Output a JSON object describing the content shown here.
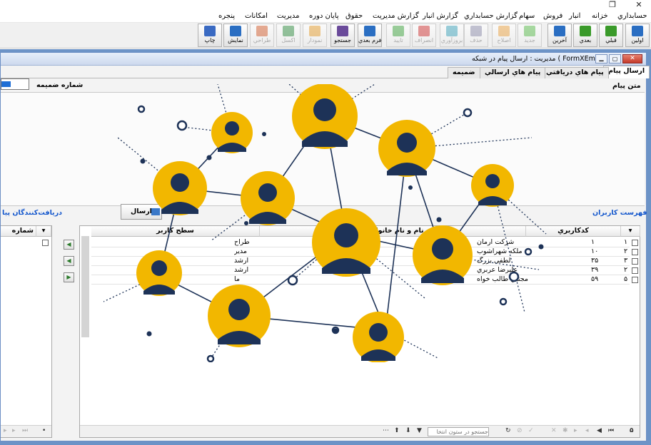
{
  "window": {
    "restore_icon": "restore-icon",
    "close_icon": "close-icon"
  },
  "menu": [
    "حسابداري",
    "خزانه",
    "انبار",
    "فروش",
    "سهام",
    "گزارش حسابداري",
    "گزارش انبار",
    "گزارش مديريت",
    "حقوق",
    "پايان دوره",
    "مديريت",
    "امكانات",
    "پنجره"
  ],
  "toolbar": [
    {
      "label": "اولين",
      "icon": "up-arrow-icon",
      "color": "#2a6ec2",
      "enabled": true
    },
    {
      "label": "قبلي",
      "icon": "right-arrow-icon",
      "color": "#3a9a2a",
      "enabled": true
    },
    {
      "label": "بعدي",
      "icon": "left-arrow-icon",
      "color": "#3a9a2a",
      "enabled": true
    },
    {
      "label": "آخرين",
      "icon": "down-arrow-icon",
      "color": "#2a6ec2",
      "enabled": true
    },
    {
      "label": "جديد",
      "icon": "plus-icon",
      "color": "#56b848",
      "enabled": false
    },
    {
      "label": "اصلاح",
      "icon": "pencil-icon",
      "color": "#e8a040",
      "enabled": false
    },
    {
      "label": "حذف",
      "icon": "trash-icon",
      "color": "#8a8aa8",
      "enabled": false
    },
    {
      "label": "بروزآوري",
      "icon": "refresh-icon",
      "color": "#39a0b8",
      "enabled": false
    },
    {
      "label": "انصراف",
      "icon": "cancel-icon",
      "color": "#cc3030",
      "enabled": false
    },
    {
      "label": "تاييد",
      "icon": "check-icon",
      "color": "#3aa03a",
      "enabled": false
    },
    {
      "label": "فرم بعدي",
      "icon": "window-icon",
      "color": "#2a6ec2",
      "enabled": true
    },
    {
      "label": "جستجو",
      "icon": "binoculars-icon",
      "color": "#6a4a9a",
      "enabled": true
    },
    {
      "label": "نمودار",
      "icon": "bar-chart-icon",
      "color": "#e29a2a",
      "enabled": false
    },
    {
      "label": "اكسل",
      "icon": "excel-icon",
      "color": "#2e8a3e",
      "enabled": false
    },
    {
      "label": "طراحي",
      "icon": "brush-icon",
      "color": "#d05a2a",
      "enabled": false
    },
    {
      "label": "نمايش",
      "icon": "preview-icon",
      "color": "#2a6ec2",
      "enabled": true
    },
    {
      "label": "چاپ",
      "icon": "printer-icon",
      "color": "#3a6ac2",
      "enabled": true
    }
  ],
  "form": {
    "title": "مديريت : ارسال پيام در شبكه ( FormXEmail)",
    "tabs": [
      "ارسال پيام",
      "پيام هاي دريافتي",
      "پيام هاي ارسالي",
      "ضميمه"
    ],
    "attachment_number_label": "شماره ضميمه",
    "message_text_label": "متن پيام",
    "users_list_label": "فهرست كاربران",
    "recipients_label": "دريافت‌كنندگان پيا",
    "send_button": "ارسال"
  },
  "users_grid": {
    "columns": [
      "كدكاربري",
      "نام و نام خانوادگي",
      "سطح كاربر"
    ],
    "rows": [
      {
        "marker": "۱",
        "code": "۱",
        "name": "شركت آرمان",
        "level": "طراح"
      },
      {
        "marker": "۲",
        "code": "۱۰",
        "name": "ملكه شهرآشوب",
        "level": "مدير"
      },
      {
        "marker": "۳",
        "code": "۳۵",
        "name": "لطفي بزرگ",
        "level": "ارشد"
      },
      {
        "marker": "۲",
        "code": "۳۹",
        "name": "عليرضا عربري",
        "level": "ارشد"
      },
      {
        "marker": "۵",
        "code": "۵۹",
        "name": "مجتبي طالب خواه",
        "level": "ما"
      }
    ],
    "record_count": "۵",
    "search_placeholder": "جستجو در ستون انتخا"
  },
  "recipients_grid": {
    "columns": [
      "شماره"
    ]
  }
}
